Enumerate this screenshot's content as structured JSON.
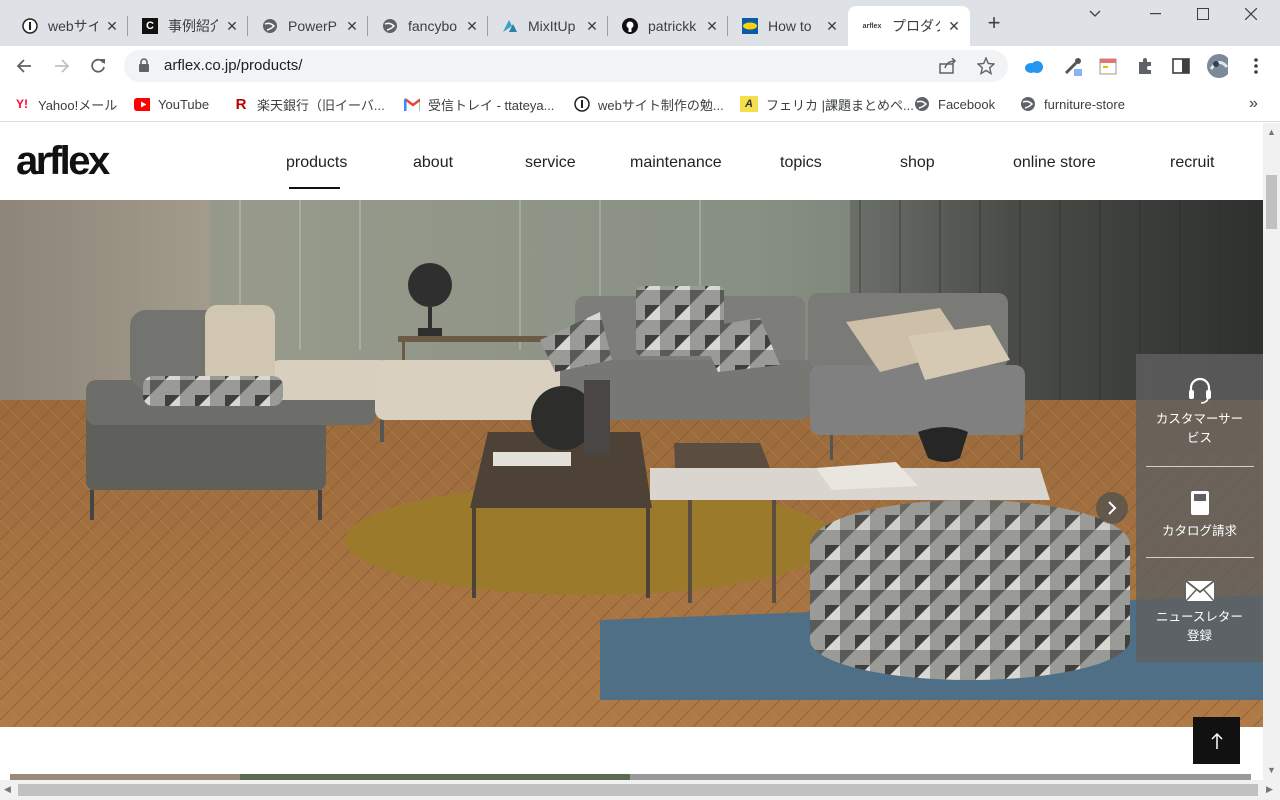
{
  "browser": {
    "tabs": [
      {
        "title": "webサイ",
        "icon": "circle-i-icon"
      },
      {
        "title": "事例紹介",
        "icon": "c-logo-icon"
      },
      {
        "title": "PowerP",
        "icon": "globe-icon"
      },
      {
        "title": "fancybo",
        "icon": "globe-icon"
      },
      {
        "title": "MixItUp",
        "icon": "mixitup-icon"
      },
      {
        "title": "patrickk",
        "icon": "github-icon"
      },
      {
        "title": "How to",
        "icon": "ikea-icon"
      },
      {
        "title": "プロダク",
        "icon": "arflex-icon"
      }
    ],
    "url": "arflex.co.jp/products/",
    "bookmarks": [
      {
        "label": "Yahoo!メール",
        "icon": "yahoo-icon"
      },
      {
        "label": "YouTube",
        "icon": "youtube-icon"
      },
      {
        "label": "楽天銀行（旧イーバ...",
        "icon": "rakuten-icon"
      },
      {
        "label": "受信トレイ - ttateya...",
        "icon": "gmail-icon"
      },
      {
        "label": "webサイト制作の勉...",
        "icon": "circle-i-icon"
      },
      {
        "label": "フェリカ |課題まとめペ...",
        "icon": "a-logo-icon"
      },
      {
        "label": "Facebook",
        "icon": "globe-icon"
      },
      {
        "label": "furniture-store",
        "icon": "globe-icon"
      }
    ],
    "bookmarks_more": "»"
  },
  "site": {
    "logo": "arflex",
    "nav": [
      "products",
      "about",
      "service",
      "maintenance",
      "topics",
      "shop",
      "online store",
      "recruit"
    ],
    "active_nav": "products",
    "side_panel": {
      "customer_service": "カスタマーサー\nビス",
      "catalog": "カタログ請求",
      "newsletter": "ニュースレター\n登録"
    }
  },
  "colors": {
    "tabbar": "#dee1e6",
    "side_panel": "#5f5f5f",
    "to_top": "#111111"
  }
}
